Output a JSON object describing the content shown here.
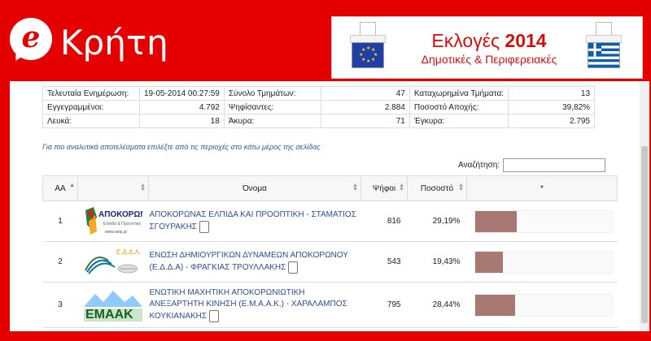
{
  "header": {
    "logo_letter": "e",
    "logo_text": "Κρήτη",
    "banner_title_prefix": "Εκλογές",
    "banner_title_year": "2014",
    "banner_subtitle": "Δημοτικές & Περιφερειακές"
  },
  "stats": [
    [
      "Τελευταία Ενημέρωση:",
      "19-05-2014 00:27:59",
      "Σύνολο Τμημάτων:",
      "47",
      "Καταχωρημένα Τμήματα:",
      "13"
    ],
    [
      "Εγγεγραμμένοι:",
      "4.792",
      "Ψηφίσαντες:",
      "2.884",
      "Ποσοστό Αποχής:",
      "39,82%"
    ],
    [
      "Λευκά:",
      "18",
      "Άκυρα:",
      "71",
      "Έγκυρα:",
      "2.795"
    ]
  ],
  "hint": "Για πιο αναλυτικά αποτελέσματα επιλέξτε από τις περιοχές στο κάτω μέρος της σελίδας",
  "search": {
    "label": "Αναζήτηση:",
    "value": ""
  },
  "table": {
    "headers": {
      "aa": "ΑΑ",
      "logo": "",
      "name": "Όνομα",
      "votes": "Ψήφοι",
      "percent": "Ποσοστό",
      "bar": "*"
    },
    "rows": [
      {
        "aa": "1",
        "logo_text": "ΑΠΟΚΟΡΩΝΑΣ",
        "logo_sub": "Ελπίδα & Προοπτική",
        "logo_sub2": "www.aelp.gr",
        "name": "ΑΠΟΚΟΡΩΝΑΣ ΕΛΠΙΔΑ ΚΑΙ ΠΡΟΟΠΤΙΚΗ - ΣΤΑΜΑΤΙΟΣ ΣΓΟΥΡΑΚΗΣ",
        "votes": "816",
        "percent": "29,19%",
        "share": 29.19
      },
      {
        "aa": "2",
        "logo_text": "Ε.Δ.Δ.Α.",
        "logo_sub": "",
        "logo_sub2": "",
        "name": "ΕΝΩΣΗ ΔΗΜΙΟΥΡΓΙΚΩΝ ΔΥΝΑΜΕΩΝ ΑΠΟΚΟΡΩΝΟΥ (Ε.Δ.Δ.Α) - ΦΡΑΓΚΙΑΣ ΤΡΟΥΛΛΑΚΗΣ",
        "votes": "543",
        "percent": "19,43%",
        "share": 19.43
      },
      {
        "aa": "3",
        "logo_text": "ΕΜΑΑΚ",
        "logo_sub": "",
        "logo_sub2": "",
        "name": "ΕΝΩΤΙΚΗ ΜΑΧΗΤΙΚΗ ΑΠΟΚΟΡΩΝΙΩΤΙΚΗ ΑΝΕΞΑΡΤΗΤΗ ΚΙΝΗΣΗ (Ε.Μ.Α.Α.Κ.) - ΧΑΡΑΛΑΜΠΟΣ ΚΟΥΚΙΑΝΑΚΗΣ",
        "votes": "795",
        "percent": "28,44%",
        "share": 28.44
      }
    ]
  },
  "colors": {
    "brand_red": "#e50000",
    "bar": "#a87872",
    "link_blue": "#2a4f9e"
  }
}
